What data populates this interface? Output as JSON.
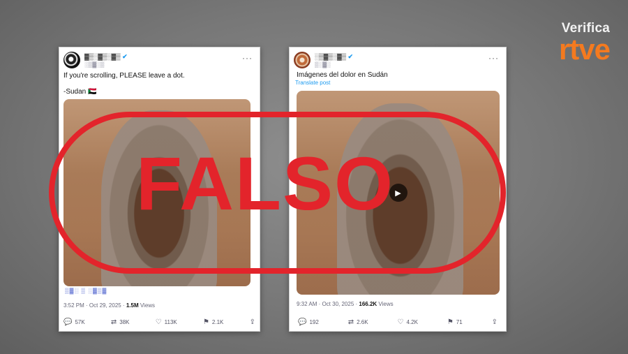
{
  "brand": {
    "verifica": "Verifica",
    "rtve": "rtve"
  },
  "stamp": {
    "text": "FALSO",
    "color": "#e3242b"
  },
  "posts": [
    {
      "line1": "If you're scrolling, PLEASE leave a dot.",
      "line2": "-Sudan 🇸🇩",
      "meta_time": "3:52 PM · Oct 29, 2025 · ",
      "views": "1.5M",
      "views_label": " Views",
      "stats": {
        "replies": "57K",
        "reposts": "38K",
        "likes": "113K",
        "bookmarks": "2.1K"
      }
    },
    {
      "line1": "Imágenes del dolor en Sudán",
      "translate": "Translate post",
      "meta_time": "9:32 AM · Oct 30, 2025 · ",
      "views": "166.2K",
      "views_label": " Views",
      "stats": {
        "replies": "192",
        "reposts": "2.6K",
        "likes": "4.2K",
        "bookmarks": "71"
      }
    }
  ],
  "icons": [
    "more-icon",
    "reply-icon",
    "repost-icon",
    "like-icon",
    "bookmark-icon",
    "share-icon",
    "play-icon",
    "verified-icon"
  ]
}
